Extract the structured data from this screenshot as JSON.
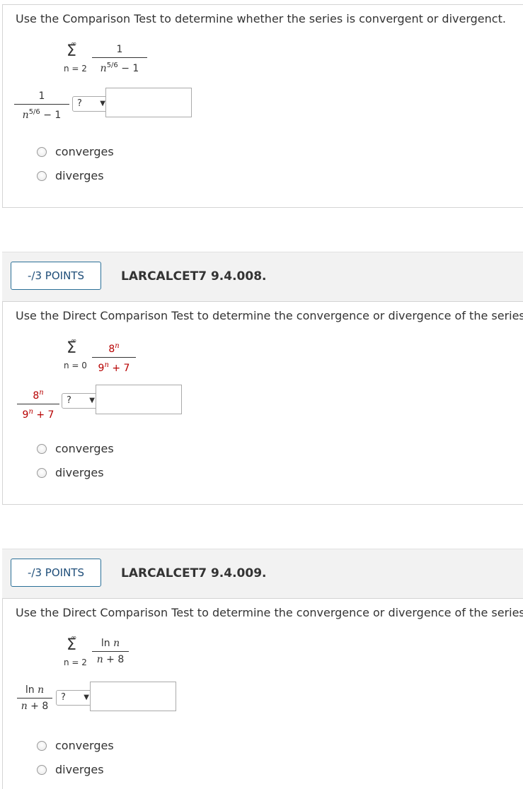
{
  "q1": {
    "question": "Use the Comparison Test to determine whether the series is convergent or divergenct.",
    "sum": {
      "upper": "∞",
      "symbol": "Σ",
      "lower": "n = 2"
    },
    "term_num": "1",
    "term_den_base": "n",
    "term_den_exp": "5/6",
    "term_den_rest": " − 1",
    "select_value": "?",
    "options": [
      "converges",
      "diverges"
    ]
  },
  "q2": {
    "points": "-/3 POINTS",
    "code": "LARCALCET7 9.4.008.",
    "question": "Use the Direct Comparison Test to determine the convergence or divergence of the series.",
    "sum": {
      "upper": "∞",
      "symbol": "Σ",
      "lower": "n = 0"
    },
    "term_num_base": "8",
    "term_num_exp": "n",
    "term_den_base": "9",
    "term_den_exp": "n",
    "term_den_rest": " + 7",
    "select_value": "?",
    "options": [
      "converges",
      "diverges"
    ]
  },
  "q3": {
    "points": "-/3 POINTS",
    "code": "LARCALCET7 9.4.009.",
    "question": "Use the Direct Comparison Test to determine the convergence or divergence of the series.",
    "sum": {
      "upper": "∞",
      "symbol": "Σ",
      "lower": "n = 2"
    },
    "term_num_fn": "ln ",
    "term_num_var": "n",
    "term_den_var": "n",
    "term_den_rest": " + 8",
    "select_value": "?",
    "options": [
      "converges",
      "diverges"
    ]
  },
  "icons": {
    "dropdown": "triangle-down"
  },
  "colors": {
    "points_border": "#2a6f97",
    "highlight": "#b70000"
  }
}
